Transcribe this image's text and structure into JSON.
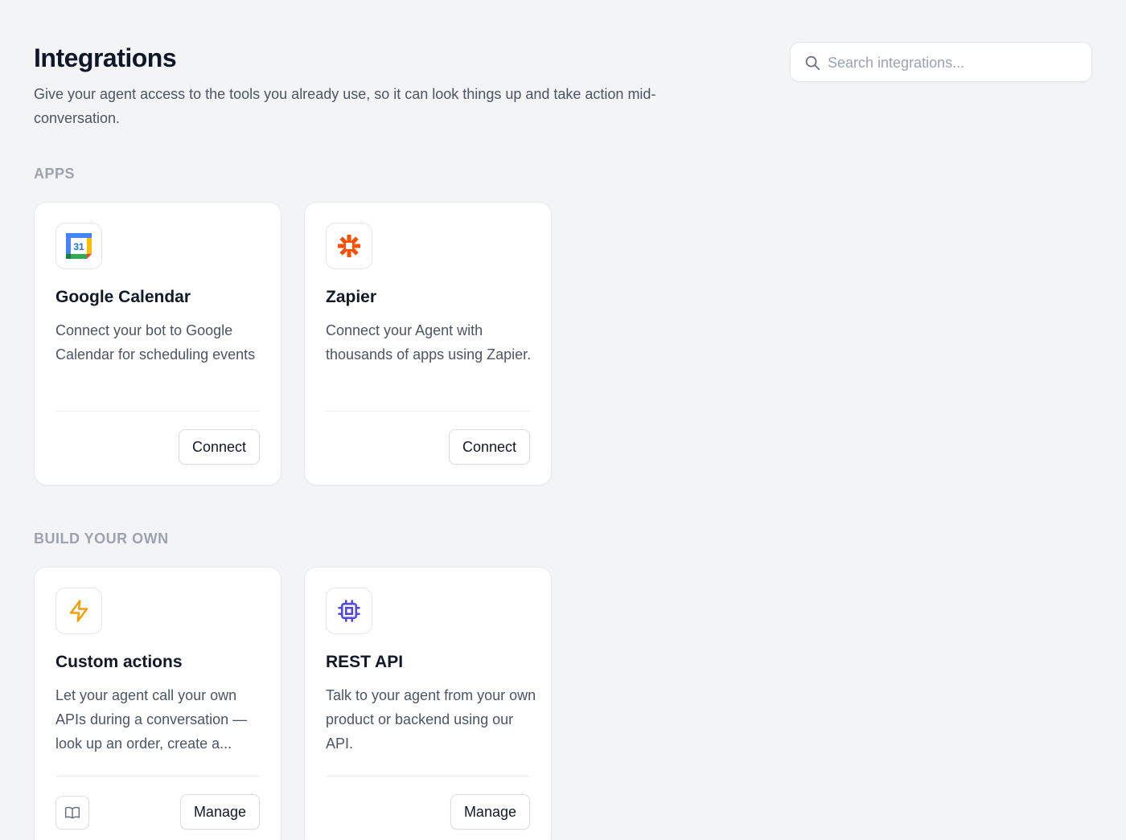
{
  "header": {
    "title": "Integrations",
    "subtitle": "Give your agent access to the tools you already use, so it can look things up and take action mid-conversation."
  },
  "search": {
    "placeholder": "Search integrations...",
    "value": "",
    "icon": "search-icon"
  },
  "sections": {
    "apps": {
      "label": "APPS",
      "cards": [
        {
          "name": "Google Calendar",
          "description": "Connect your bot to Google Calendar for scheduling events",
          "icon": "google-calendar-icon",
          "icon_text": "31",
          "action_label": "Connect"
        },
        {
          "name": "Zapier",
          "description": "Connect your Agent with thousands of apps using Zapier.",
          "icon": "zapier-icon",
          "icon_color": "#ff4f00",
          "action_label": "Connect"
        }
      ]
    },
    "build": {
      "label": "BUILD YOUR OWN",
      "cards": [
        {
          "name": "Custom actions",
          "description": "Let your agent call your own APIs during a conversation — look up an order, create a...",
          "icon": "lightning-bolt-icon",
          "icon_color": "#f59e0b",
          "secondary_icon": "book-icon",
          "action_label": "Manage"
        },
        {
          "name": "REST API",
          "description": "Talk to your agent from your own product or backend using our API.",
          "icon": "cpu-chip-icon",
          "icon_color": "#4f46e5",
          "action_label": "Manage"
        }
      ]
    }
  }
}
